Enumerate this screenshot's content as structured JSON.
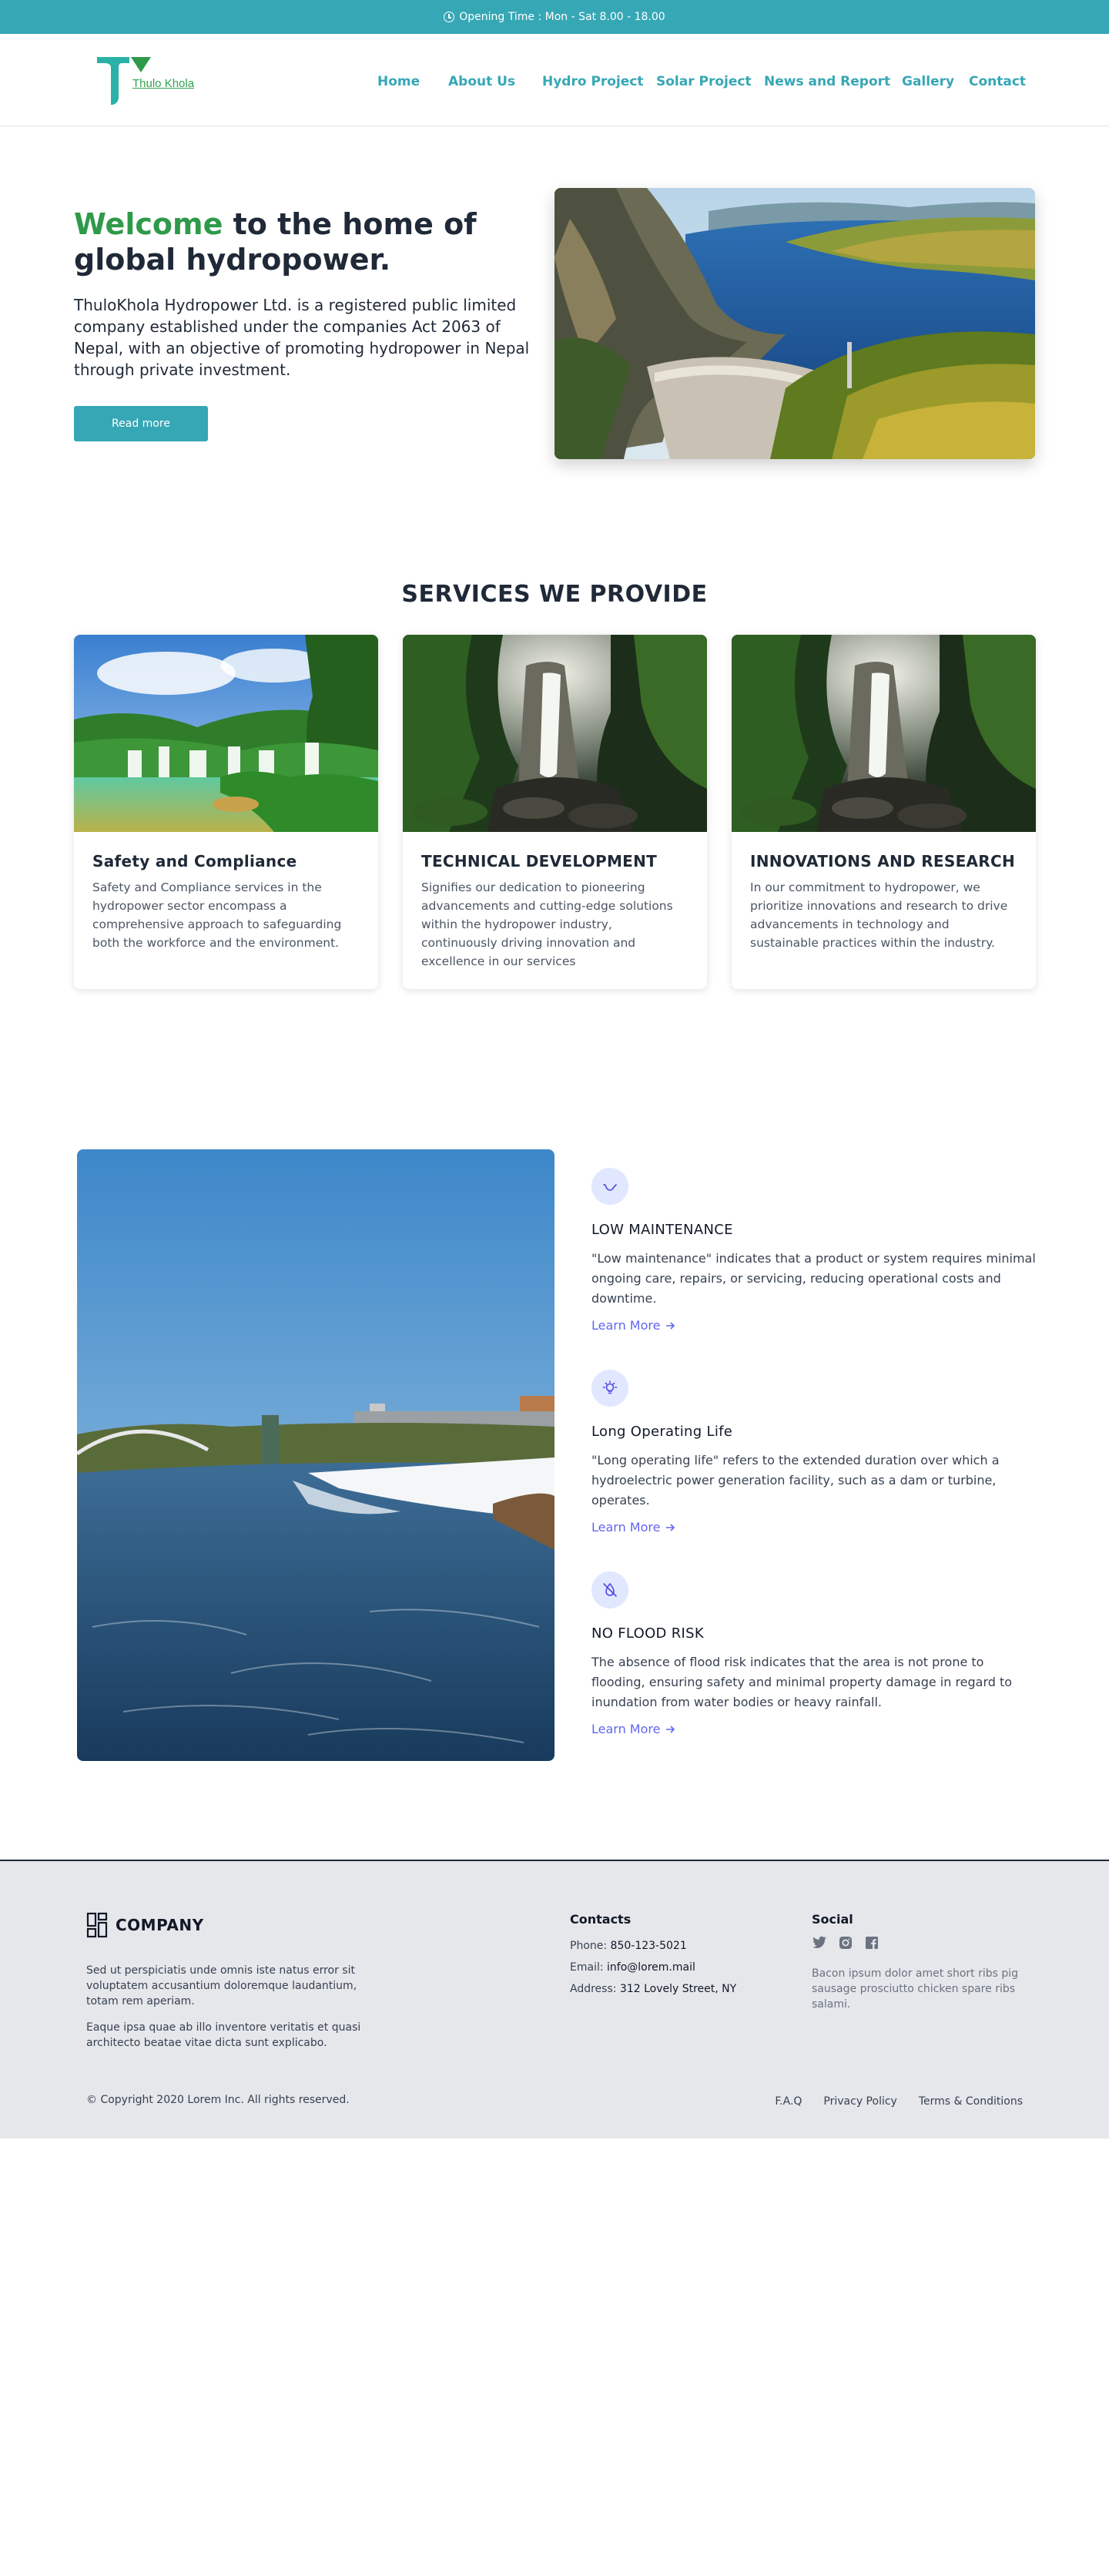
{
  "topbar": {
    "text": "Opening Time : Mon - Sat 8.00 - 18.00"
  },
  "brand": {
    "logo_text": "Thulo Khola"
  },
  "nav": {
    "items": [
      "Home",
      "About Us",
      "Hydro Project",
      "Solar Project",
      "News and Report",
      "Gallery",
      "Contact"
    ]
  },
  "hero": {
    "title_accent": "Welcome",
    "title_rest": " to the home of global hydropower.",
    "description": "ThuloKhola Hydropower Ltd. is a registered public limited company established under the companies Act 2063 of Nepal, with an objective of promoting hydropower in Nepal through private investment.",
    "button": "Read more"
  },
  "services": {
    "title": "SERVICES WE PROVIDE",
    "cards": [
      {
        "title": "Safety and Compliance",
        "text": "Safety and Compliance services in the hydropower sector encompass a comprehensive approach to safeguarding both the workforce and the environment."
      },
      {
        "title": "TECHNICAL DEVELOPMENT",
        "text": "Signifies our dedication to pioneering advancements and cutting-edge solutions within the hydropower industry, continuously driving innovation and excellence in our services"
      },
      {
        "title": "INNOVATIONS AND RESEARCH",
        "text": "In our commitment to hydropower, we prioritize innovations and research to drive advancements in technology and sustainable practices within the industry."
      }
    ]
  },
  "features": [
    {
      "icon": "wave-icon",
      "title": "LOW MAINTENANCE",
      "text": "\"Low maintenance\" indicates that a product or system requires minimal ongoing care, repairs, or servicing, reducing operational costs and downtime.",
      "link": "Learn More"
    },
    {
      "icon": "lightbulb-icon",
      "title": "Long Operating Life",
      "text": "\"Long operating life\" refers to the extended duration over which a hydroelectric power generation facility, such as a dam or turbine, operates.",
      "link": "Learn More"
    },
    {
      "icon": "no-drop-icon",
      "title": "NO FLOOD RISK",
      "text": "The absence of flood risk indicates that the area is not prone to flooding, ensuring safety and minimal property damage in regard to inundation from water bodies or heavy rainfall.",
      "link": "Learn More"
    }
  ],
  "footer": {
    "company": "COMPANY",
    "about_1": "Sed ut perspiciatis unde omnis iste natus error sit voluptatem accusantium doloremque laudantium, totam rem aperiam.",
    "about_2": "Eaque ipsa quae ab illo inventore veritatis et quasi architecto beatae vitae dicta sunt explicabo.",
    "contacts_title": "Contacts",
    "phone_label": "Phone: ",
    "phone": "850-123-5021",
    "email_label": "Email: ",
    "email": "info@lorem.mail",
    "address_label": "Address: ",
    "address": "312 Lovely Street, NY",
    "social_title": "Social",
    "social_text": "Bacon ipsum dolor amet short ribs pig sausage prosciutto chicken spare ribs salami.",
    "copyright": "© Copyright 2020 Lorem Inc. All rights reserved.",
    "links": [
      "F.A.Q",
      "Privacy Policy",
      "Terms & Conditions"
    ]
  },
  "colors": {
    "primary": "#36a7b5",
    "accent_green": "#2e9a4a",
    "link_indigo": "#6366f1",
    "footer_bg": "#e5e7eb"
  }
}
